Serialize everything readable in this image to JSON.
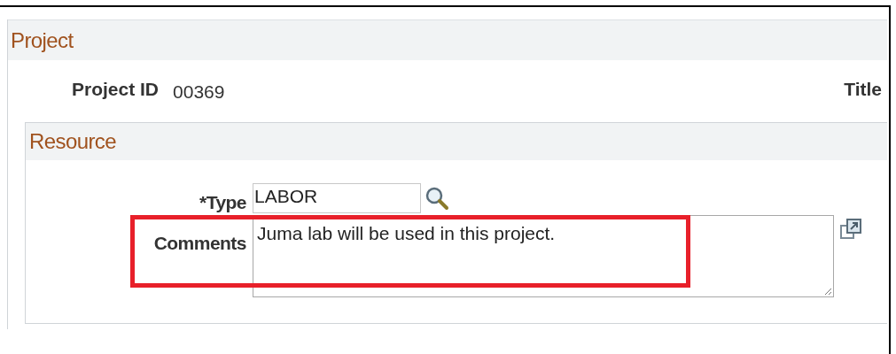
{
  "project": {
    "title": "Project",
    "id_label": "Project ID",
    "id_value": "00369",
    "title_label": "Title"
  },
  "resource": {
    "title": "Resource",
    "type_label": "*Type",
    "type_value": "LABOR",
    "comments_label": "Comments",
    "comments_value": "Juma lab will be used in this project."
  },
  "annotation": {
    "highlighted": true
  }
}
